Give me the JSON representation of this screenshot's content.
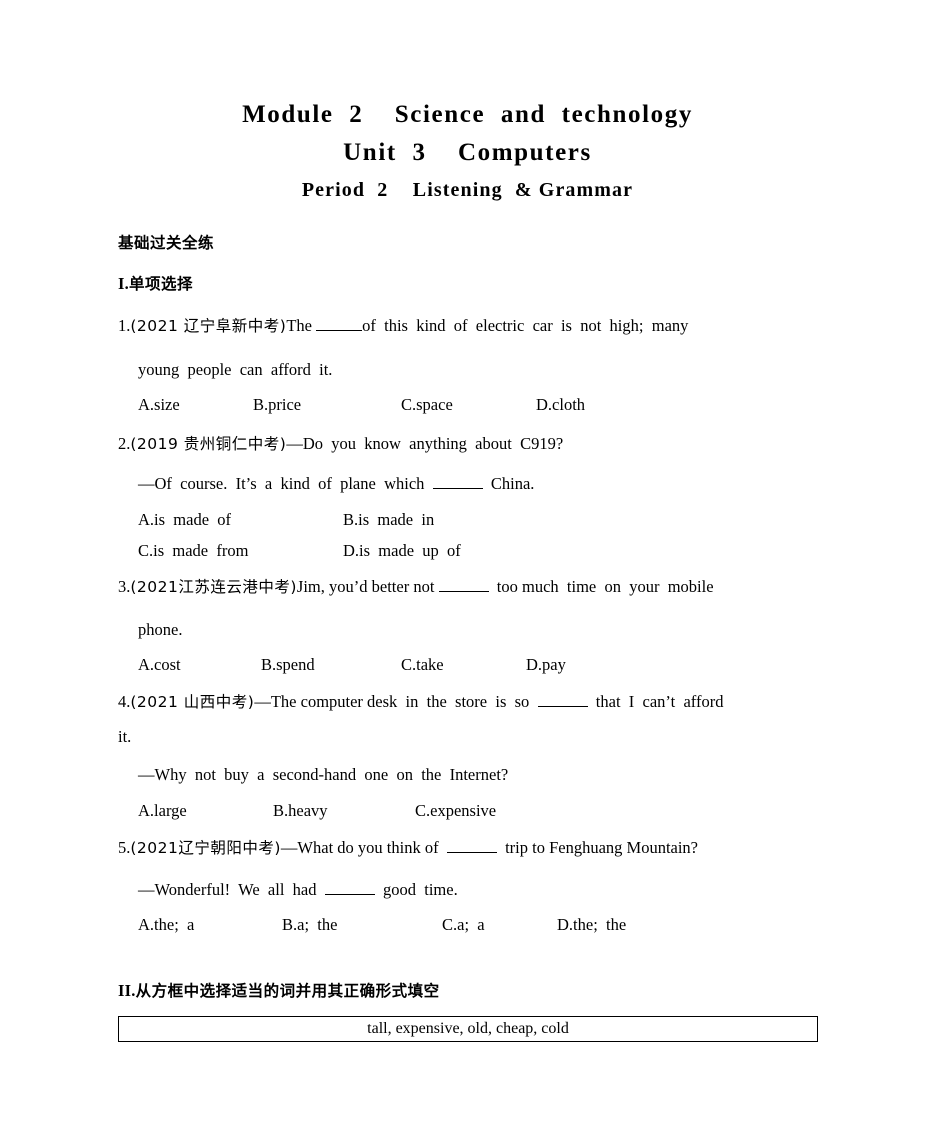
{
  "document": {
    "title_line_1": "Module  2    Science  and  technology",
    "title_line_2": "Unit  3    Computers",
    "title_line_3": "Period  2    Listening  & Grammar"
  },
  "sections": {
    "basic_drill_header": "基础过关全练",
    "section_1_roman": "I.",
    "section_1_header": "单项选择",
    "section_2_roman": "II.",
    "section_2_header": "从方框中选择适当的词并用其正确形式填空"
  },
  "questions": [
    {
      "number": "1.",
      "source": "(2021 辽宁阜新中考)",
      "stem_before_blank": "The ",
      "stem_after_blank": "of  this  kind  of  electric  car  is  not  high;  many",
      "stem_line_2": "young  people  can  afford  it.",
      "options": [
        "A.size",
        "B.price",
        "C.space",
        "D.cloth"
      ]
    },
    {
      "number": "2.",
      "source": "(2019 贵州铜仁中考)",
      "stem_line_1": "—Do  you  know  anything  about  C919?",
      "stem_line_2_before_blank": "—Of  course.  It’s  a  kind  of  plane  which  ",
      "stem_line_2_after_blank": "  China.",
      "options": [
        "A.is  made  of",
        "B.is  made  in",
        "C.is  made  from",
        "D.is  made  up  of"
      ]
    },
    {
      "number": "3.",
      "source": "(2021江苏连云港中考)",
      "stem_before_blank": "Jim, you’d better not ",
      "stem_after_blank": "  too much  time  on  your  mobile",
      "stem_line_2": "phone.",
      "options": [
        "A.cost",
        "B.spend",
        "C.take",
        "D.pay"
      ]
    },
    {
      "number": "4.",
      "source": "(2021 山西中考)",
      "stem_before_blank": "—The computer desk  in  the  store  is  so  ",
      "stem_after_blank": "  that  I  can’t  afford",
      "stem_line_2": "it.",
      "stem_line_3": "—Why  not  buy  a  second-hand  one  on  the  Internet?",
      "options": [
        "A.large",
        "B.heavy",
        "C.expensive"
      ]
    },
    {
      "number": "5.",
      "source": "(2021辽宁朝阳中考)",
      "stem_before_blank": "—What do you think of  ",
      "stem_after_blank": "  trip to Fenghuang Mountain?",
      "stem_line_2_before_blank": "—Wonderful!  We  all  had  ",
      "stem_line_2_after_blank": "  good  time.",
      "options": [
        "A.the;  a",
        "B.a;  the",
        "C.a;  a",
        "D.the;  the"
      ]
    }
  ],
  "word_bank": {
    "words": "tall, expensive, old, cheap, cold"
  }
}
